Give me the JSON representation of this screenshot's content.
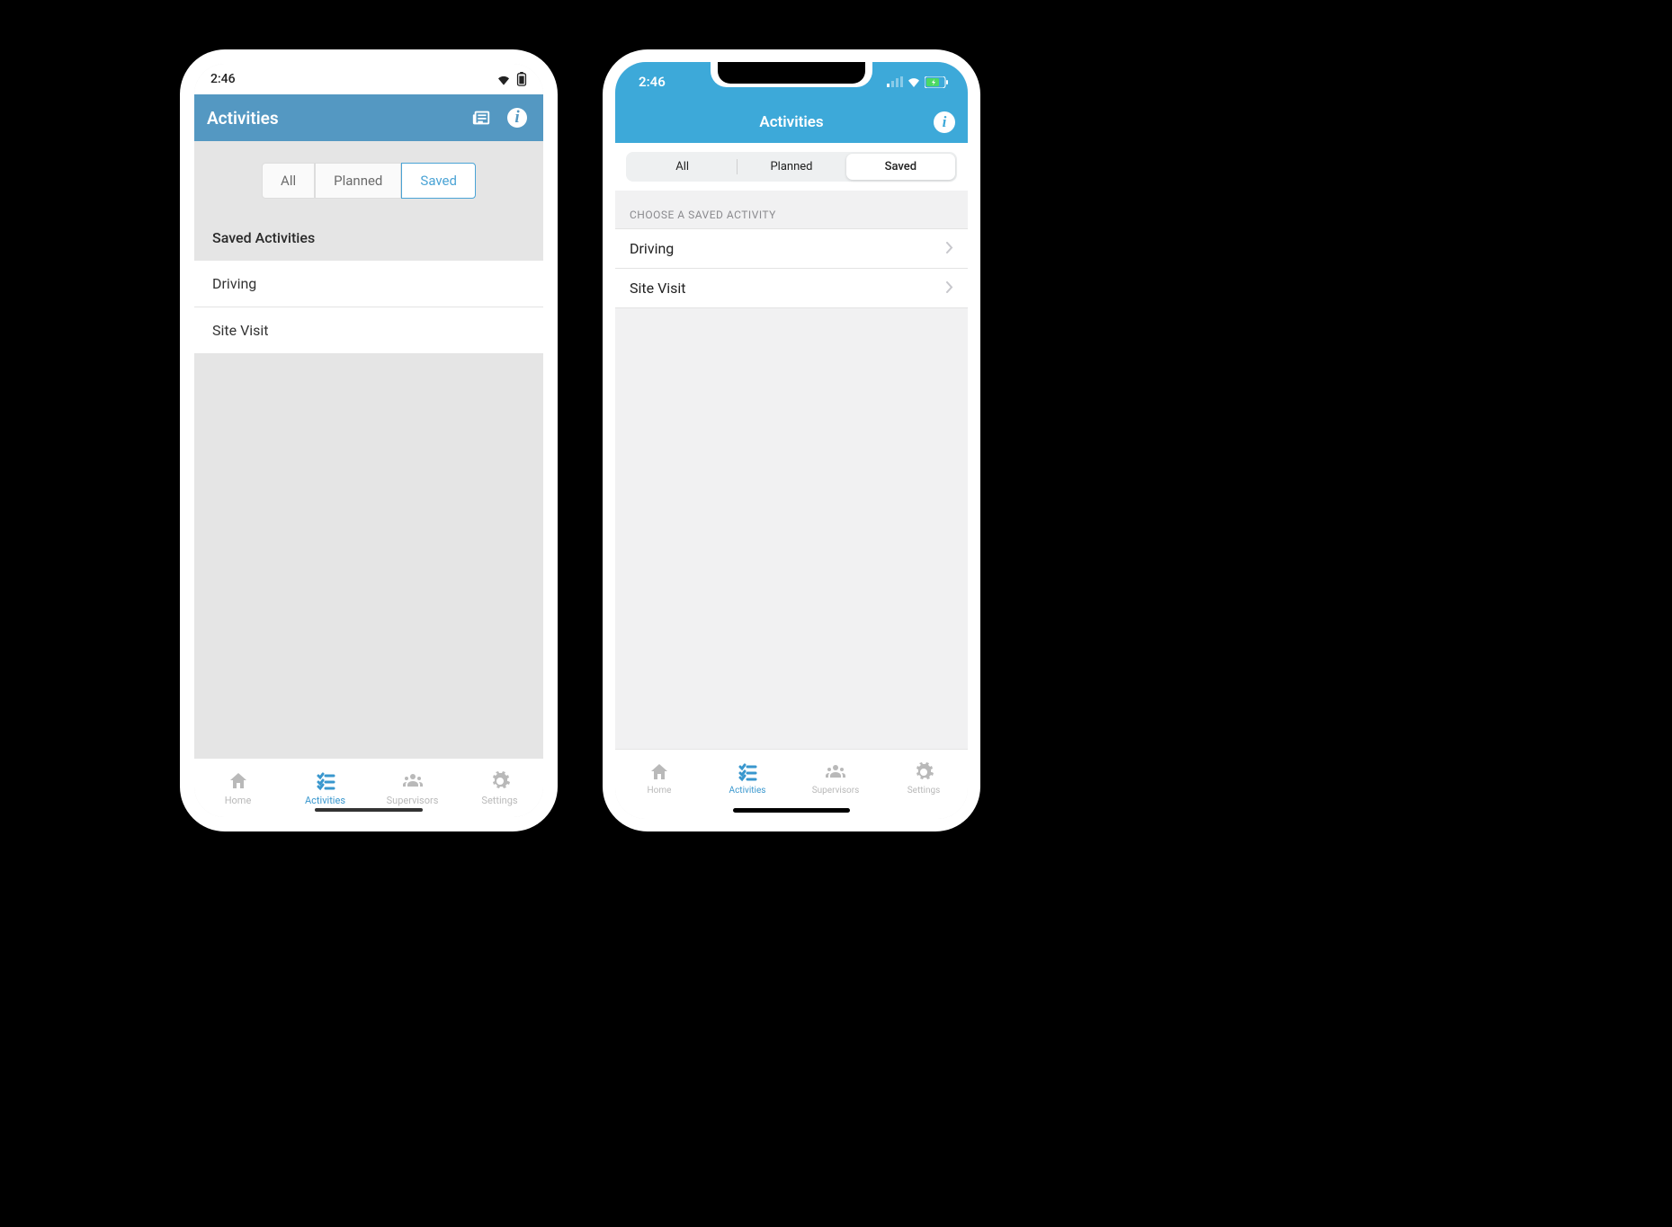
{
  "android": {
    "status": {
      "time": "2:46"
    },
    "header": {
      "title": "Activities"
    },
    "segments": {
      "items": [
        "All",
        "Planned",
        "Saved"
      ],
      "active": 2
    },
    "section": {
      "title": "Saved Activities"
    },
    "list": {
      "items": [
        "Driving",
        "Site Visit"
      ]
    },
    "tabs": {
      "items": [
        "Home",
        "Activities",
        "Supervisors",
        "Settings"
      ],
      "active": 1
    }
  },
  "ios": {
    "status": {
      "time": "2:46"
    },
    "header": {
      "title": "Activities"
    },
    "segments": {
      "items": [
        "All",
        "Planned",
        "Saved"
      ],
      "active": 2
    },
    "section": {
      "title": "CHOOSE A SAVED ACTIVITY"
    },
    "list": {
      "items": [
        "Driving",
        "Site Visit"
      ]
    },
    "tabs": {
      "items": [
        "Home",
        "Activities",
        "Supervisors",
        "Settings"
      ],
      "active": 1
    }
  },
  "colors": {
    "android_header": "#5498c2",
    "ios_header": "#3da9d9",
    "accent": "#3997ce"
  }
}
